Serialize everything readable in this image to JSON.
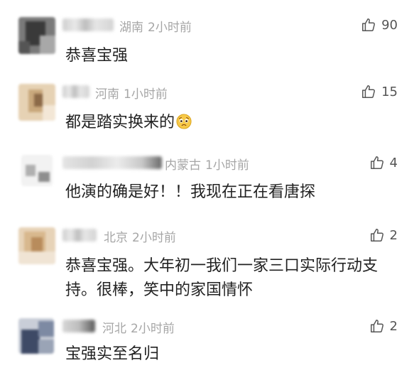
{
  "comments": [
    {
      "location": "湖南",
      "time": "2小时前",
      "likes": "90",
      "text": "恭喜宝强"
    },
    {
      "location": "河南",
      "time": "1小时前",
      "likes": "15",
      "text": "都是踏实换来的",
      "emoji": "pleading-face-emoji"
    },
    {
      "location": "内蒙古",
      "time": "1小时前",
      "likes": "4",
      "text": "他演的确是好！！我现在正在看唐探"
    },
    {
      "location": "北京",
      "time": "2小时前",
      "likes": "2",
      "text": "恭喜宝强。大年初一我们一家三口实际行动支持。很棒，笑中的家国情怀"
    },
    {
      "location": "河北",
      "time": "2小时前",
      "likes": "2",
      "text": "宝强实至名归"
    }
  ],
  "icons": {
    "like": "thumbs-up-icon"
  },
  "colors": {
    "meta": "#a6a6a6",
    "text": "#222222",
    "count": "#555555"
  }
}
